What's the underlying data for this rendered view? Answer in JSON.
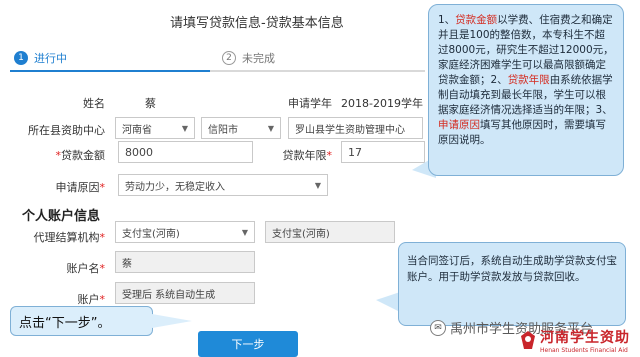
{
  "page": {
    "title": "请填写贷款信息-贷款基本信息"
  },
  "steps": [
    {
      "number": "1",
      "label": "进行中",
      "state": "active"
    },
    {
      "number": "2",
      "label": "未完成",
      "state": "pending"
    }
  ],
  "form": {
    "name_label": "姓名",
    "name_value": "蔡",
    "year_label": "申请学年",
    "year_value": "2018-2019学年",
    "center_label": "所在县资助中心",
    "province_value": "河南省",
    "city_value": "信阳市",
    "center_value": "罗山县学生资助管理中心",
    "amount_label": "贷款金额",
    "amount_value": "8000",
    "term_label": "贷款年限",
    "term_value": "17",
    "reason_label": "申请原因",
    "reason_value": "劳动力少，无稳定收入"
  },
  "account": {
    "section_title": "个人账户信息",
    "agent_label": "代理结算机构",
    "agent_value_1": "支付宝(河南)",
    "agent_value_2": "支付宝(河南)",
    "account_name_label": "账户名",
    "account_name_value": "蔡",
    "account_label": "账户",
    "account_value": "受理后 系统自动生成"
  },
  "callout_top": {
    "p1": "1、",
    "h1": "贷款金额",
    "p2": "以学费、住宿费之和确定并且是100的整倍数，本专科生不超过8000元，研究生不超过12000元，家庭经济困难学生可以最高限额确定贷款金额；2、",
    "h2": "贷款年限",
    "p3": "由系统依据学制自动填充到最长年限，学生可以根据家庭经济情况选择适当的年限；3、",
    "h3": "申请原因",
    "p4": "填写其他原因时，需要填写原因说明。"
  },
  "callout_bottom": {
    "text": "当合同签订后，系统自动生成助学贷款支付宝账户。用于助学贷款发放与贷款回收。"
  },
  "hint": {
    "text": "点击“下一步”。"
  },
  "buttons": {
    "next_label": "下一步"
  },
  "watermark": {
    "text": "禹州市学生资助服务平台",
    "logo_text": "河南学生资助",
    "logo_sub": "Henan Students Financial Aid"
  },
  "colors": {
    "accent": "#1f8ad8",
    "highlight": "#d42a1f",
    "callout_bg": "#cfe7f8",
    "logo": "#c9252b"
  }
}
